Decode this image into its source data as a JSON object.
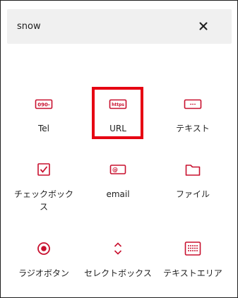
{
  "search": {
    "value": "snow",
    "clear_icon": "close-icon"
  },
  "blocks": [
    {
      "label": "Tel",
      "icon": "tel-icon",
      "badge": "090-"
    },
    {
      "label": "URL",
      "icon": "url-icon",
      "badge": "https",
      "selected": true
    },
    {
      "label": "テキスト",
      "icon": "text-icon",
      "badge": "---"
    },
    {
      "label": "チェックボックス",
      "icon": "checkbox-icon"
    },
    {
      "label": "email",
      "icon": "email-icon"
    },
    {
      "label": "ファイル",
      "icon": "folder-icon"
    },
    {
      "label": "ラジオボタン",
      "icon": "radio-icon"
    },
    {
      "label": "セレクトボックス",
      "icon": "select-icon"
    },
    {
      "label": "テキストエリア",
      "icon": "textarea-icon"
    }
  ],
  "colors": {
    "accent": "#c8102e",
    "highlight": "#e60012",
    "search_bg": "#f0f0f0",
    "text": "#1e1e1e"
  }
}
